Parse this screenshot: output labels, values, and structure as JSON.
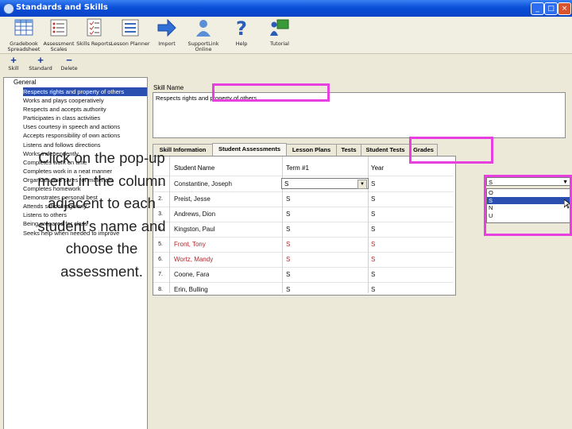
{
  "window": {
    "title": "Standards and Skills",
    "controls": {
      "minimize": "_",
      "maximize": "□",
      "close": "×"
    }
  },
  "toolbar": {
    "gradebook": "Gradebook Spreadsheet",
    "assessment_scales": "Assessment Scales",
    "skills_reports": "Skills Reports",
    "lesson_planner": "Lesson Planner",
    "import": "Import",
    "support_link": "SupportLink Online",
    "help": "Help",
    "tutorial": "Tutorial"
  },
  "subbar": {
    "skill": {
      "symbol": "+",
      "label": "Skill"
    },
    "standard": {
      "symbol": "+",
      "label": "Standard"
    },
    "delete": {
      "symbol": "−",
      "label": "Delete"
    }
  },
  "tree": {
    "root": "General",
    "items": [
      "Respects rights and property of others",
      "Works and plays cooperatively",
      "Respects and accepts authority",
      "Participates in class activities",
      "Uses courtesy in speech and actions",
      "Accepts responsibility of own actions",
      "Listens and follows directions",
      "Works independently",
      "Completes work on time",
      "Completes work in a neat manner",
      "Organizes and cares for materials",
      "Completes homework",
      "Demonstrates personal best",
      "Attends school regularly",
      "Listens to others",
      "Being prepared for class",
      "Seeks help when needed to improve"
    ]
  },
  "overlay": {
    "text": "Click on the pop-up menu in the column adjacent to each student’s name and choose the assessment."
  },
  "skill": {
    "label": "Skill Name",
    "value": "Respects rights and property of others"
  },
  "tabs": [
    "Skill Information",
    "Student Assessments",
    "Lesson Plans",
    "Tests",
    "Student Tests",
    "Grades"
  ],
  "grid": {
    "headers": [
      "Student Name",
      "Term #1",
      "Year"
    ],
    "rows": [
      {
        "num": "1.",
        "name": "Constantine, Joseph",
        "term": "S",
        "year": "S",
        "color": "#111111"
      },
      {
        "num": "2.",
        "name": "Preist, Jesse",
        "term": "S",
        "year": "S",
        "color": "#111111"
      },
      {
        "num": "3.",
        "name": "Andrews, Dion",
        "term": "S",
        "year": "S",
        "color": "#111111"
      },
      {
        "num": "4.",
        "name": "Kingston, Paul",
        "term": "S",
        "year": "S",
        "color": "#111111"
      },
      {
        "num": "5.",
        "name": "Front, Tony",
        "term": "S",
        "year": "S",
        "color": "#b3262a"
      },
      {
        "num": "6.",
        "name": "Wortz, Mandy",
        "term": "S",
        "year": "S",
        "color": "#b3262a"
      },
      {
        "num": "7.",
        "name": "Coone, Fara",
        "term": "S",
        "year": "S",
        "color": "#111111"
      },
      {
        "num": "8.",
        "name": "Erin, Bulling",
        "term": "S",
        "year": "S",
        "color": "#111111"
      }
    ]
  },
  "dropdown": {
    "current": "S",
    "options": [
      "O",
      "S",
      "N",
      "U"
    ],
    "highlighted": "S"
  },
  "colors": {
    "highlight_box": "#e83fe0",
    "selection": "#2b4fb0",
    "titlebar": "#0a4fd8"
  }
}
